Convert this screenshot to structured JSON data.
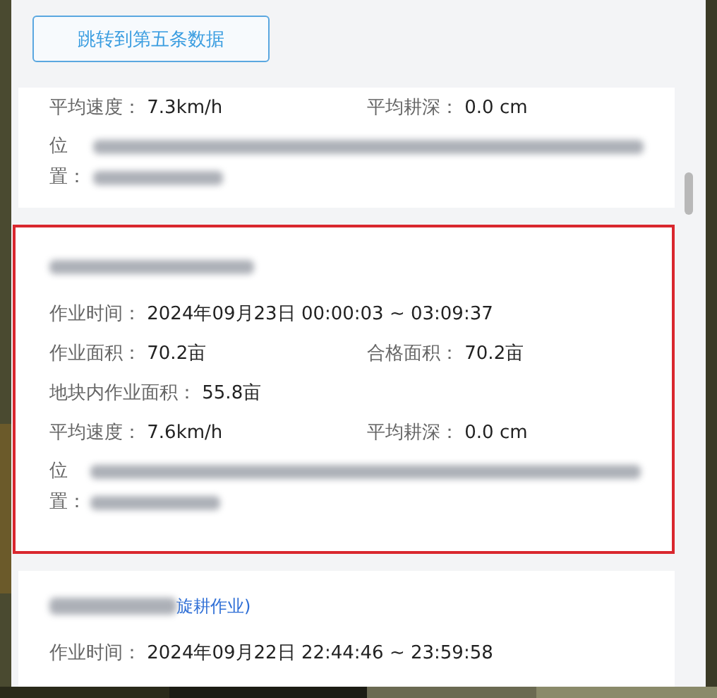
{
  "jump_button": "跳转到第五条数据",
  "records": [
    {
      "selected": false,
      "rows": [
        {
          "kind": "fields",
          "items": [
            {
              "label": "平均速度：",
              "value": "7.3km/h"
            },
            {
              "label": "平均耕深：",
              "value": "0.0 cm"
            }
          ]
        },
        {
          "kind": "location",
          "label": "位置："
        }
      ]
    },
    {
      "selected": true,
      "title": {
        "kind": "redacted"
      },
      "rows": [
        {
          "kind": "fields",
          "items": [
            {
              "label": "作业时间：",
              "value": "2024年09月23日 00:00:03 ~ 03:09:37"
            }
          ]
        },
        {
          "kind": "fields",
          "items": [
            {
              "label": "作业面积：",
              "value": "70.2亩"
            },
            {
              "label": "合格面积：",
              "value": "70.2亩"
            }
          ]
        },
        {
          "kind": "fields",
          "items": [
            {
              "label": "地块内作业面积：",
              "value": "55.8亩"
            }
          ]
        },
        {
          "kind": "fields",
          "items": [
            {
              "label": "平均速度：",
              "value": "7.6km/h"
            },
            {
              "label": "平均耕深：",
              "value": "0.0 cm"
            }
          ]
        },
        {
          "kind": "location",
          "label": "位置："
        }
      ]
    },
    {
      "selected": false,
      "title": {
        "kind": "partly_redacted",
        "text": "旋耕作业)"
      },
      "rows": [
        {
          "kind": "fields",
          "items": [
            {
              "label": "作业时间：",
              "value": "2024年09月22日 22:44:46 ~ 23:59:58"
            }
          ]
        }
      ]
    }
  ]
}
